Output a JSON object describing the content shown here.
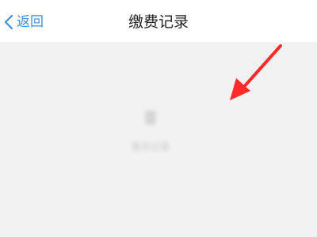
{
  "nav": {
    "back_label": "返回",
    "title": "缴费记录"
  },
  "empty_state": {
    "icon": "document-icon",
    "text": "暂无记录"
  },
  "annotation": {
    "color": "#ff2a2a"
  },
  "colors": {
    "accent": "#3d8fe0",
    "background": "#f2f2f2",
    "title_text": "#222222"
  }
}
